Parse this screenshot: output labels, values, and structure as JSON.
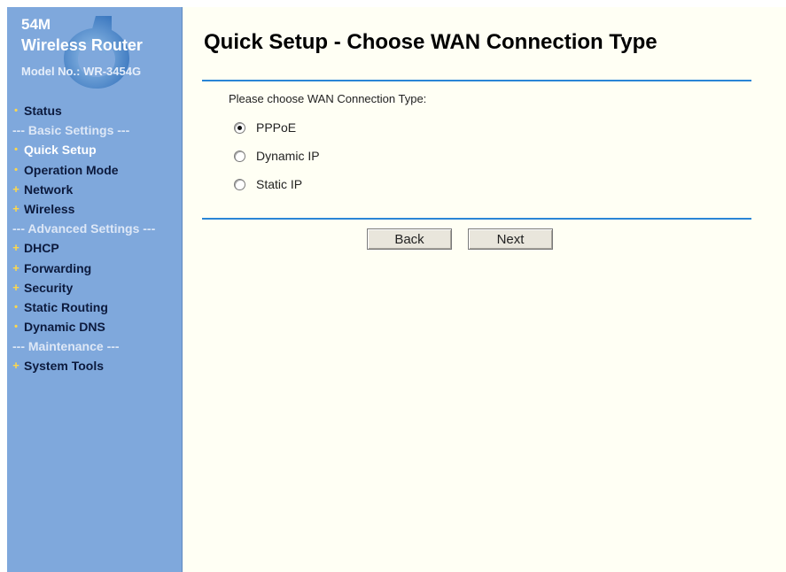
{
  "brand": {
    "line1": "54M",
    "line2": "Wireless Router",
    "line3": "Model No.: WR-3454G"
  },
  "menu": [
    {
      "label": "Status",
      "type": "item",
      "bullet": "dot"
    },
    {
      "label": "--- Basic Settings ---",
      "type": "section"
    },
    {
      "label": "Quick Setup",
      "type": "item",
      "bullet": "dot",
      "active": true
    },
    {
      "label": "Operation Mode",
      "type": "item",
      "bullet": "dot"
    },
    {
      "label": "Network",
      "type": "item",
      "bullet": "plus"
    },
    {
      "label": "Wireless",
      "type": "item",
      "bullet": "plus"
    },
    {
      "label": "--- Advanced Settings ---",
      "type": "section"
    },
    {
      "label": "DHCP",
      "type": "item",
      "bullet": "plus"
    },
    {
      "label": "Forwarding",
      "type": "item",
      "bullet": "plus"
    },
    {
      "label": "Security",
      "type": "item",
      "bullet": "plus"
    },
    {
      "label": "Static Routing",
      "type": "item",
      "bullet": "dot"
    },
    {
      "label": "Dynamic DNS",
      "type": "item",
      "bullet": "dot"
    },
    {
      "label": "--- Maintenance ---",
      "type": "section"
    },
    {
      "label": "System Tools",
      "type": "item",
      "bullet": "plus"
    }
  ],
  "page": {
    "title": "Quick Setup - Choose WAN Connection Type",
    "prompt": "Please choose WAN Connection Type:"
  },
  "options": [
    {
      "label": "PPPoE",
      "checked": true
    },
    {
      "label": "Dynamic IP",
      "checked": false
    },
    {
      "label": "Static IP",
      "checked": false
    }
  ],
  "buttons": {
    "back": "Back",
    "next": "Next"
  },
  "colors": {
    "sidebar_bg": "#7fa8dc",
    "content_bg": "#fffff4",
    "divider": "#2a85d6",
    "menu_text": "#0c1a3d",
    "menu_active": "#ffffff",
    "bullet": "#ffd84a"
  }
}
